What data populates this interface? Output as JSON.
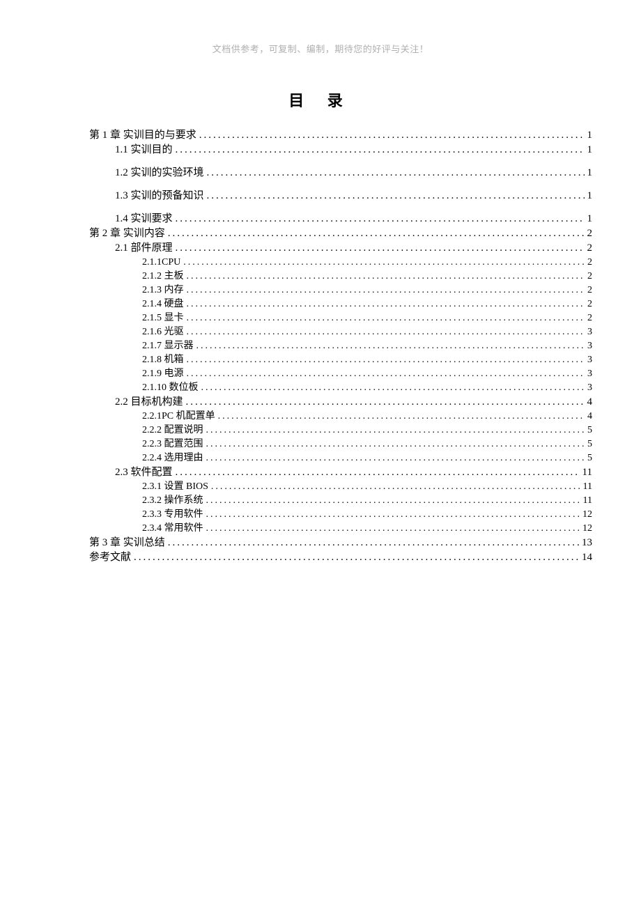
{
  "header_note": "文档供参考，可复制、编制，期待您的好评与关注！",
  "title": "目  录",
  "toc": [
    {
      "level": 0,
      "label": "第 1 章   实训目的与要求",
      "page": "1",
      "tight": true
    },
    {
      "level": 1,
      "label": "1.1 实训目的",
      "page": "1"
    },
    {
      "level": 1,
      "label": "1.2 实训的实验环境",
      "page": "1"
    },
    {
      "level": 1,
      "label": "1.3 实训的预备知识",
      "page": "1"
    },
    {
      "level": 1,
      "label": "1.4 实训要求",
      "page": "1",
      "tight": true
    },
    {
      "level": 0,
      "label": "第 2 章   实训内容",
      "page": "2",
      "tight": true
    },
    {
      "level": 1,
      "label": "2.1 部件原理",
      "page": "2",
      "tight": true
    },
    {
      "level": 2,
      "label": "2.1.1CPU",
      "page": "2"
    },
    {
      "level": 2,
      "label": "2.1.2 主板",
      "page": "2"
    },
    {
      "level": 2,
      "label": "2.1.3 内存",
      "page": "2"
    },
    {
      "level": 2,
      "label": "2.1.4 硬盘",
      "page": "2"
    },
    {
      "level": 2,
      "label": "2.1.5 显卡",
      "page": "2"
    },
    {
      "level": 2,
      "label": "2.1.6 光驱",
      "page": "3"
    },
    {
      "level": 2,
      "label": "2.1.7 显示器",
      "page": "3"
    },
    {
      "level": 2,
      "label": "2.1.8 机箱",
      "page": "3"
    },
    {
      "level": 2,
      "label": "2.1.9 电源",
      "page": "3"
    },
    {
      "level": 2,
      "label": "2.1.10 数位板",
      "page": "3"
    },
    {
      "level": 1,
      "label": "2.2 目标机构建",
      "page": "4",
      "tight": true
    },
    {
      "level": 2,
      "label": "2.2.1PC 机配置单",
      "page": "4"
    },
    {
      "level": 2,
      "label": "2.2.2 配置说明",
      "page": "5"
    },
    {
      "level": 2,
      "label": "2.2.3 配置范围",
      "page": "5"
    },
    {
      "level": 2,
      "label": "2.2.4 选用理由",
      "page": "5"
    },
    {
      "level": 1,
      "label": "2.3 软件配置",
      "page": "11",
      "tight": true
    },
    {
      "level": 2,
      "label": "2.3.1 设置 BIOS",
      "page": "11"
    },
    {
      "level": 2,
      "label": "2.3.2 操作系统",
      "page": "11"
    },
    {
      "level": 2,
      "label": "2.3.3 专用软件",
      "page": "12"
    },
    {
      "level": 2,
      "label": "2.3.4 常用软件",
      "page": "12"
    },
    {
      "level": 0,
      "label": "第 3 章   实训总结",
      "page": "13",
      "tight": true
    },
    {
      "level": 0,
      "label": "参考文献",
      "page": "14",
      "tight": true
    }
  ]
}
